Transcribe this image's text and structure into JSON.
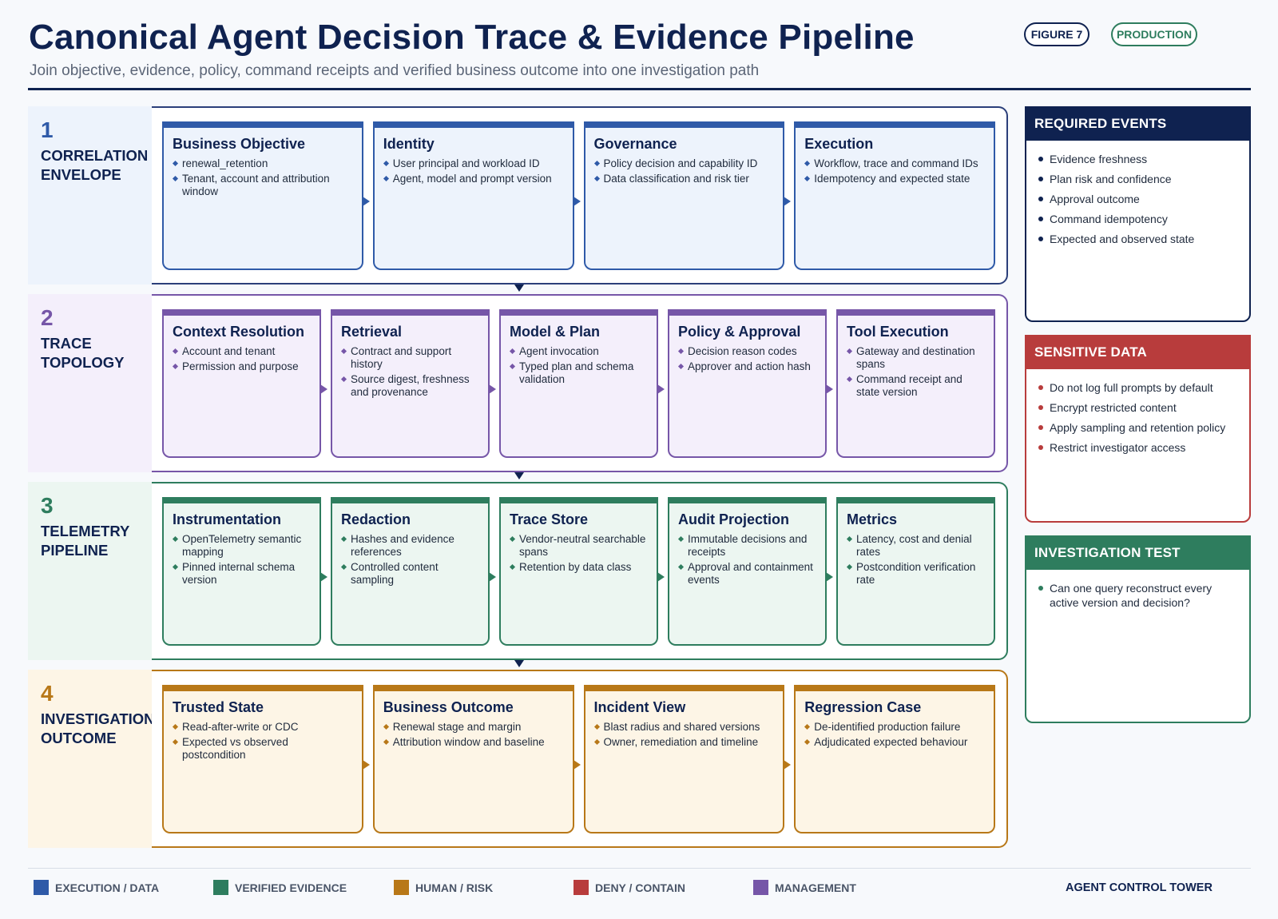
{
  "header": {
    "title": "Canonical Agent Decision Trace & Evidence Pipeline",
    "subtitle": "Join objective, evidence, policy, command receipts and verified business outcome into one investigation path",
    "figure_badge": "FIGURE 7",
    "env_badge": "PRODUCTION"
  },
  "colors": {
    "navy": "#0f2250",
    "execution_blue": "#2f5aa8",
    "evidence_green": "#2e7d5e",
    "risk_orange": "#b87818",
    "deny_red": "#b83c3c",
    "management_purple": "#7656a8"
  },
  "rows": [
    {
      "number": "1",
      "name": "CORRELATION ENVELOPE",
      "stages": [
        {
          "title": "Business Objective",
          "bullets": [
            "renewal_retention",
            "Tenant, account and attribution window"
          ]
        },
        {
          "title": "Identity",
          "bullets": [
            "User principal and workload ID",
            "Agent, model and prompt version"
          ]
        },
        {
          "title": "Governance",
          "bullets": [
            "Policy decision and capability ID",
            "Data classification and risk tier"
          ]
        },
        {
          "title": "Execution",
          "bullets": [
            "Workflow, trace and command IDs",
            "Idempotency and expected state"
          ]
        }
      ]
    },
    {
      "number": "2",
      "name": "TRACE TOPOLOGY",
      "stages": [
        {
          "title": "Context Resolution",
          "bullets": [
            "Account and tenant",
            "Permission and purpose"
          ]
        },
        {
          "title": "Retrieval",
          "bullets": [
            "Contract and support history",
            "Source digest, freshness and provenance"
          ]
        },
        {
          "title": "Model & Plan",
          "bullets": [
            "Agent invocation",
            "Typed plan and schema validation"
          ]
        },
        {
          "title": "Policy & Approval",
          "bullets": [
            "Decision reason codes",
            "Approver and action hash"
          ]
        },
        {
          "title": "Tool Execution",
          "bullets": [
            "Gateway and destination spans",
            "Command receipt and state version"
          ]
        }
      ]
    },
    {
      "number": "3",
      "name": "TELEMETRY PIPELINE",
      "stages": [
        {
          "title": "Instrumentation",
          "bullets": [
            "OpenTelemetry semantic mapping",
            "Pinned internal schema version"
          ]
        },
        {
          "title": "Redaction",
          "bullets": [
            "Hashes and evidence references",
            "Controlled content sampling"
          ]
        },
        {
          "title": "Trace Store",
          "bullets": [
            "Vendor-neutral searchable spans",
            "Retention by data class"
          ]
        },
        {
          "title": "Audit Projection",
          "bullets": [
            "Immutable decisions and receipts",
            "Approval and containment events"
          ]
        },
        {
          "title": "Metrics",
          "bullets": [
            "Latency, cost and denial rates",
            "Postcondition verification rate"
          ]
        }
      ]
    },
    {
      "number": "4",
      "name": "INVESTIGATION OUTCOME",
      "stages": [
        {
          "title": "Trusted State",
          "bullets": [
            "Read-after-write or CDC",
            "Expected vs observed postcondition"
          ]
        },
        {
          "title": "Business Outcome",
          "bullets": [
            "Renewal stage and margin",
            "Attribution window and baseline"
          ]
        },
        {
          "title": "Incident View",
          "bullets": [
            "Blast radius and shared versions",
            "Owner, remediation and timeline"
          ]
        },
        {
          "title": "Regression Case",
          "bullets": [
            "De-identified production failure",
            "Adjudicated expected behaviour"
          ]
        }
      ]
    }
  ],
  "panels": [
    {
      "title": "REQUIRED EVENTS",
      "items": [
        "Evidence freshness",
        "Plan risk and confidence",
        "Approval outcome",
        "Command idempotency",
        "Expected and observed state"
      ]
    },
    {
      "title": "SENSITIVE DATA",
      "items": [
        "Do not log full prompts by default",
        "Encrypt restricted content",
        "Apply sampling and retention policy",
        "Restrict investigator access"
      ]
    },
    {
      "title": "INVESTIGATION TEST",
      "items": [
        "Can one query reconstruct every active version and decision?"
      ]
    }
  ],
  "legend": [
    {
      "label": "EXECUTION / DATA",
      "color": "#2f5aa8"
    },
    {
      "label": "VERIFIED EVIDENCE",
      "color": "#2e7d5e"
    },
    {
      "label": "HUMAN / RISK",
      "color": "#b87818"
    },
    {
      "label": "DENY / CONTAIN",
      "color": "#b83c3c"
    },
    {
      "label": "MANAGEMENT",
      "color": "#7656a8"
    }
  ],
  "footer": {
    "brand": "AGENT CONTROL TOWER"
  }
}
